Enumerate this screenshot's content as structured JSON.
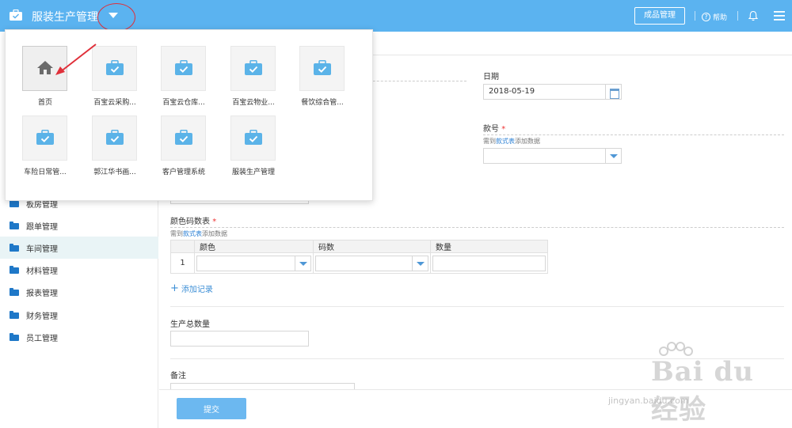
{
  "header": {
    "title": "服装生产管理",
    "products_button": "成品管理",
    "help_label": "帮助",
    "bg_color": "#5bb3f0"
  },
  "sidebar": {
    "items": [
      {
        "label": "板房管理",
        "icon": "folder-icon"
      },
      {
        "label": "跟单管理",
        "icon": "folder-icon"
      },
      {
        "label": "车间管理",
        "icon": "folder-icon",
        "active": true
      },
      {
        "label": "材料管理",
        "icon": "folder-icon"
      },
      {
        "label": "报表管理",
        "icon": "folder-icon"
      },
      {
        "label": "财务管理",
        "icon": "folder-icon"
      },
      {
        "label": "员工管理",
        "icon": "folder-icon"
      }
    ]
  },
  "app_panel": {
    "apps": [
      {
        "label": "首页",
        "icon": "home-icon"
      },
      {
        "label": "百宝云采购...",
        "icon": "briefcase-icon"
      },
      {
        "label": "百宝云仓库...",
        "icon": "briefcase-icon"
      },
      {
        "label": "百宝云物业...",
        "icon": "briefcase-icon"
      },
      {
        "label": "餐饮综合管...",
        "icon": "briefcase-icon"
      },
      {
        "label": "车险日常管...",
        "icon": "briefcase-icon"
      },
      {
        "label": "郭江华书画...",
        "icon": "briefcase-icon"
      },
      {
        "label": "客户管理系统",
        "icon": "briefcase-icon"
      },
      {
        "label": "服装生产管理",
        "icon": "briefcase-icon"
      }
    ]
  },
  "form": {
    "date": {
      "label": "日期",
      "value": "2018-05-19"
    },
    "style_no": {
      "label": "款号",
      "required": "*",
      "hint_prefix": "需到",
      "hint_link": "款式表",
      "hint_suffix": "添加数据"
    },
    "color_size_table": {
      "label": "颜色码数表",
      "required": "*",
      "hint_prefix": "需到",
      "hint_link": "款式表",
      "hint_suffix": "添加数据",
      "columns": [
        "颜色",
        "码数",
        "数量"
      ],
      "rows": [
        {
          "index": "1"
        }
      ],
      "add_record": "添加记录"
    },
    "total_qty": {
      "label": "生产总数量"
    },
    "remark": {
      "label": "备注"
    },
    "submit": "提交"
  },
  "watermark": {
    "brand": "Bai du 经验",
    "url": "jingyan.baidu.com"
  }
}
